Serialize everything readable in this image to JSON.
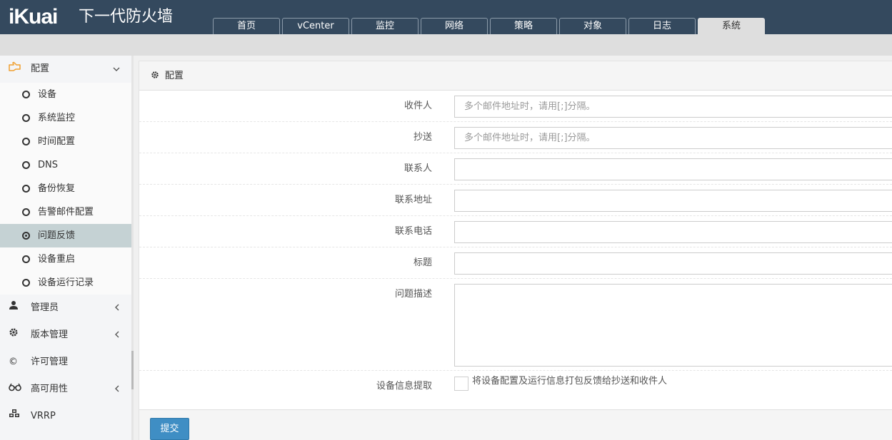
{
  "app": {
    "logo": "iKuai",
    "product": "下一代防火墙"
  },
  "nav": {
    "tabs": [
      "首页",
      "vCenter",
      "监控",
      "网络",
      "策略",
      "对象",
      "日志",
      "系统"
    ],
    "active": "系统"
  },
  "sidebar": {
    "config_group": {
      "label": "配置",
      "icon": "hand-pointer-icon"
    },
    "config_items": [
      "设备",
      "系统监控",
      "时间配置",
      "DNS",
      "备份恢复",
      "告警邮件配置",
      "问题反馈",
      "设备重启",
      "设备运行记录"
    ],
    "active_item": "问题反馈",
    "groups": [
      {
        "label": "管理员",
        "icon": "user-icon"
      },
      {
        "label": "版本管理",
        "icon": "gear-icon"
      },
      {
        "label": "许可管理",
        "icon": "copyright-icon"
      },
      {
        "label": "高可用性",
        "icon": "binoculars-icon"
      },
      {
        "label": "VRRP",
        "icon": "cubes-icon"
      }
    ]
  },
  "panel": {
    "title": "配置",
    "fields": {
      "recipient": {
        "label": "收件人",
        "placeholder": "多个邮件地址时，请用[;]分隔。"
      },
      "cc": {
        "label": "抄送",
        "placeholder": "多个邮件地址时，请用[;]分隔。"
      },
      "contact": {
        "label": "联系人",
        "value": ""
      },
      "address": {
        "label": "联系地址",
        "value": ""
      },
      "phone": {
        "label": "联系电话",
        "value": ""
      },
      "subject": {
        "label": "标题",
        "value": ""
      },
      "description": {
        "label": "问题描述",
        "value": ""
      },
      "device_info": {
        "label": "设备信息提取",
        "checkbox_text": "将设备配置及运行信息打包反馈给抄送和收件人",
        "checked": false
      }
    },
    "submit_label": "提交"
  }
}
